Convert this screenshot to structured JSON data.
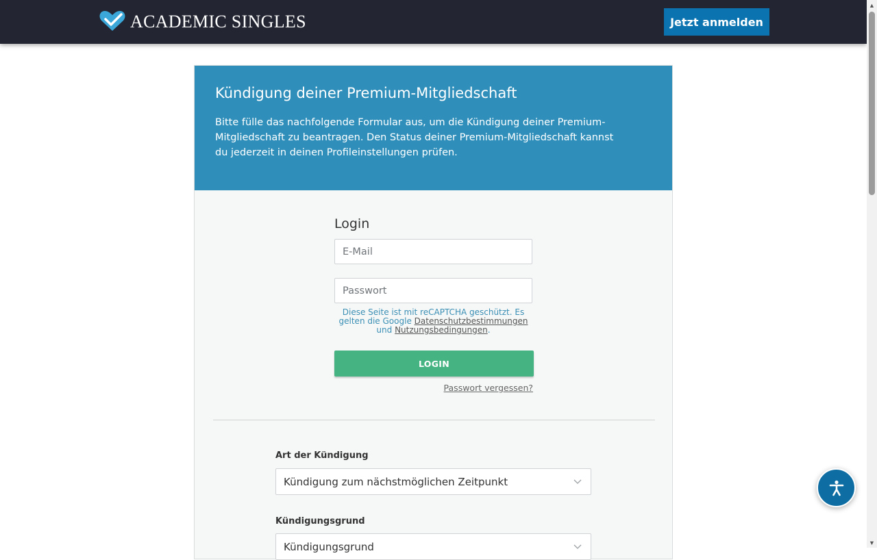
{
  "header": {
    "logo_text": "ACADEMIC SINGLES",
    "cta_label": "Jetzt anmelden"
  },
  "card": {
    "title": "Kündigung deiner Premium-Mitgliedschaft",
    "intro": "Bitte fülle das nachfolgende Formular aus, um die Kündigung deiner Premium-Mitgliedschaft zu beantragen. Den Status deiner Premium-Mitgliedschaft kannst du jederzeit in deinen Profileinstellungen prüfen."
  },
  "login": {
    "title": "Login",
    "email_placeholder": "E-Mail",
    "password_placeholder": "Passwort",
    "recaptcha_text_1": "Diese Seite ist mit reCAPTCHA geschützt. Es gelten die Google ",
    "privacy_link": "Datenschutzbestimmungen",
    "recaptcha_text_2": " und ",
    "terms_link": "Nutzungsbedingungen",
    "recaptcha_text_3": ".",
    "button_label": "LOGIN",
    "forgot_label": "Passwort vergessen?"
  },
  "form": {
    "type_label": "Art der Kündigung",
    "type_value": "Kündigung zum nächstmöglichen Zeitpunkt",
    "reason_label": "Kündigungsgrund",
    "reason_value": "Kündigungsgrund"
  },
  "colors": {
    "header_bg": "#232632",
    "cta": "#0b73b0",
    "card_head": "#2f8fba",
    "login_button": "#46b383",
    "accessibility": "#0e6ea3"
  },
  "icons": {
    "logo": "heart-check-icon",
    "accessibility": "accessibility-person-icon",
    "select": "chevron-down-icon"
  }
}
